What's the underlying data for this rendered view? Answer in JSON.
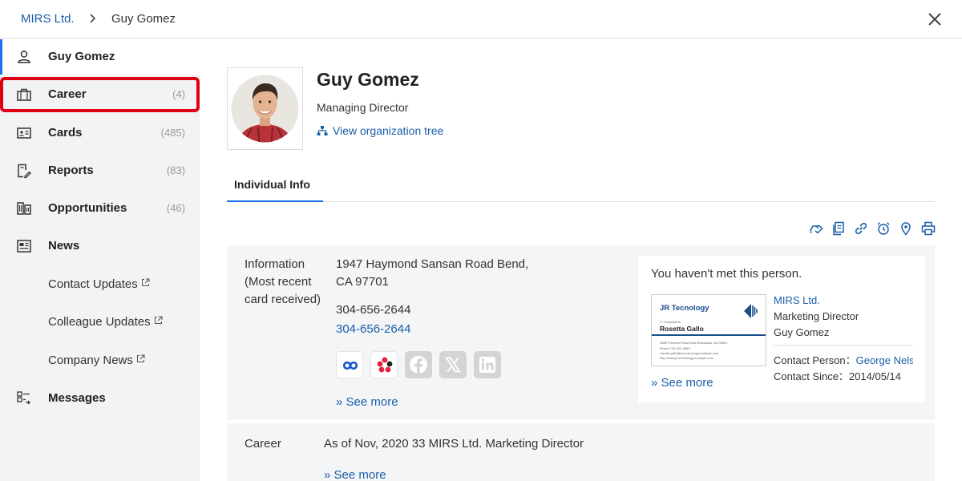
{
  "breadcrumb": {
    "parent": "MIRS Ltd.",
    "current": "Guy Gomez"
  },
  "sidebar": {
    "items": [
      {
        "label": "Guy Gomez",
        "count": "",
        "icon": "person-icon"
      },
      {
        "label": "Career",
        "count": "(4)",
        "icon": "briefcase-icon"
      },
      {
        "label": "Cards",
        "count": "(485)",
        "icon": "id-card-icon"
      },
      {
        "label": "Reports",
        "count": "(83)",
        "icon": "report-edit-icon"
      },
      {
        "label": "Opportunities",
        "count": "(46)",
        "icon": "buildings-icon"
      },
      {
        "label": "News",
        "count": "",
        "icon": "newspaper-icon"
      }
    ],
    "subitems": [
      {
        "label": "Contact Updates"
      },
      {
        "label": "Colleague Updates"
      },
      {
        "label": "Company News"
      }
    ],
    "messages": {
      "label": "Messages",
      "icon": "messages-icon"
    }
  },
  "profile": {
    "name": "Guy Gomez",
    "title": "Managing Director",
    "org_link": "View organization tree"
  },
  "tabs": [
    {
      "label": "Individual Info"
    }
  ],
  "toolbar": [
    "handshake-icon",
    "copy-icon",
    "link-icon",
    "alarm-icon",
    "location-pin-icon",
    "print-icon"
  ],
  "info": {
    "label": "Information (Most recent card received)",
    "address": "1947 Haymond Sansan Road Bend, CA 97701",
    "phone": "304-656-2644",
    "phone_link": "304-656-2644",
    "see_more": "» See more",
    "services": [
      "linked-rings-icon",
      "dots-app-icon",
      "facebook-icon",
      "x-icon",
      "linkedin-icon"
    ]
  },
  "met": {
    "text": "You haven't met this person.",
    "card": {
      "company": "JR Tecnology",
      "tiny1": "IT Consultants",
      "name": "Rosetta Gallo",
      "tiny2": "2689 Freedom Road New Brunswick, NJ 08901",
      "tiny3": "Phone 732-422-5860",
      "tiny4": "rosetta.gallo@jr-technology.example.com",
      "tiny5": "http://www.jr-technology.example.com"
    },
    "company": "MIRS Ltd.",
    "title": "Marketing Director",
    "person": "Guy Gomez",
    "contact_person_label": "Contact Person：",
    "contact_person": "George Nelson",
    "contact_since_label": "Contact Since：",
    "contact_since": "2014/05/14",
    "see_more": "» See more"
  },
  "career": {
    "label": "Career",
    "text": "As of Nov, 2020 33 MIRS Ltd. Marketing Director",
    "see_more": "» See more"
  },
  "colors": {
    "link": "#1a5ea8",
    "accent": "#1a73e8",
    "highlight": "#e00015"
  }
}
